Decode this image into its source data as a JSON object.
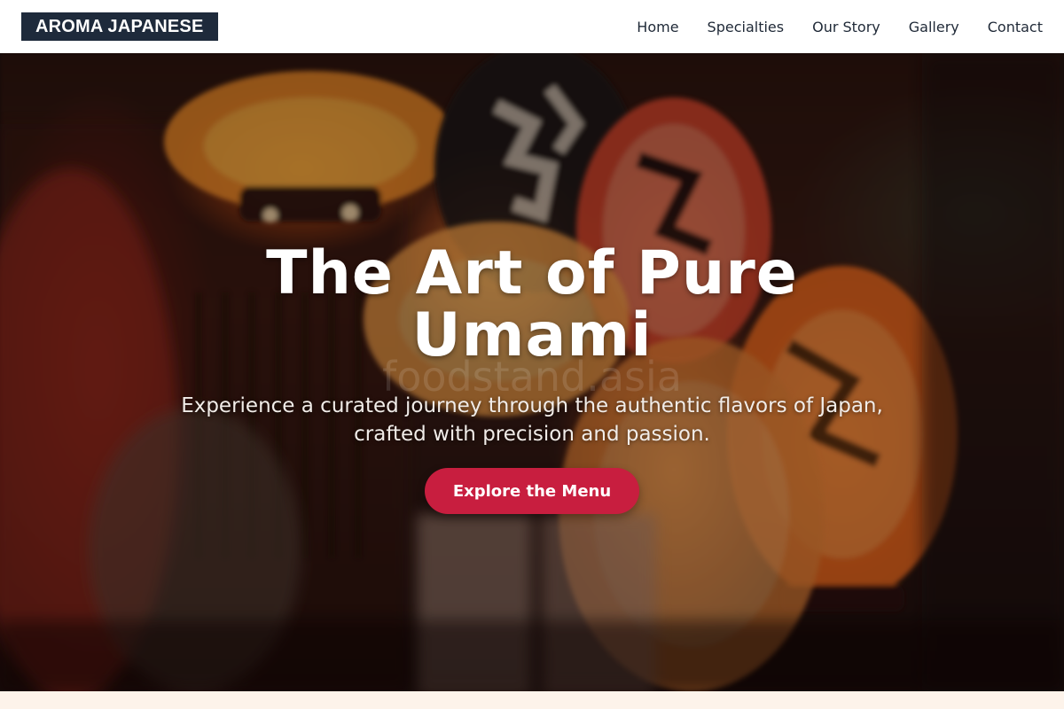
{
  "header": {
    "logo_text": "AROMA JAPANESE",
    "nav": [
      {
        "label": "Home"
      },
      {
        "label": "Specialties"
      },
      {
        "label": "Our Story"
      },
      {
        "label": "Gallery"
      },
      {
        "label": "Contact"
      }
    ]
  },
  "hero": {
    "title": "The Art of Pure Umami",
    "subtitle": "Experience a curated journey through the authentic flavors of Japan, crafted with precision and passion.",
    "cta_label": "Explore the Menu",
    "watermark": "foodstand.asia",
    "background_image": "japanese-lanterns-photo"
  },
  "colors": {
    "header_bg": "#ffffff",
    "logo_bg": "#1e2a3b",
    "nav_text": "#1f2937",
    "cta_bg": "#c81e3f",
    "page_bg": "#fdf3ea"
  }
}
